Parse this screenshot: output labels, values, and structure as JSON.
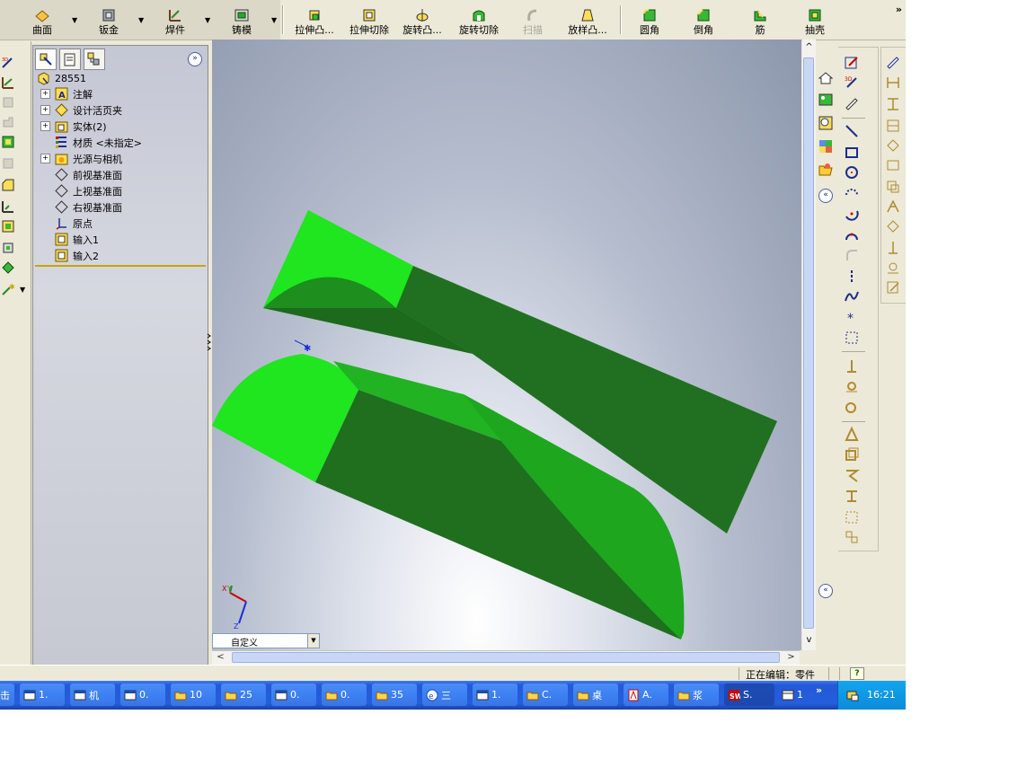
{
  "toolbar": {
    "buttons": [
      {
        "label": "曲面"
      },
      {
        "label": "钣金"
      },
      {
        "label": "焊件"
      },
      {
        "label": "铸模"
      },
      {
        "label": "拉伸凸..."
      },
      {
        "label": "拉伸切除"
      },
      {
        "label": "旋转凸..."
      },
      {
        "label": "旋转切除"
      },
      {
        "label": "扫描"
      },
      {
        "label": "放样凸..."
      },
      {
        "label": "圆角"
      },
      {
        "label": "倒角"
      },
      {
        "label": "筋"
      },
      {
        "label": "抽壳"
      }
    ],
    "more": "»"
  },
  "feature_tree": {
    "expand": "»",
    "root": "28551",
    "items": [
      {
        "label": "注解"
      },
      {
        "label": "设计活页夹"
      },
      {
        "label": "实体(2)"
      },
      {
        "label": "材质 <未指定>"
      },
      {
        "label": "光源与相机"
      },
      {
        "label": "前视基准面"
      },
      {
        "label": "上视基准面"
      },
      {
        "label": "右视基准面"
      },
      {
        "label": "原点"
      },
      {
        "label": "输入1"
      },
      {
        "label": "输入2"
      }
    ]
  },
  "viewport": {
    "view_combo": "自定义",
    "triad": {
      "x": "X",
      "y": "Y",
      "z": "Z"
    },
    "collapse": "«"
  },
  "statusbar": {
    "editing": "正在编辑：零件",
    "help": "?"
  },
  "taskbar": {
    "tasks": [
      {
        "label": "击"
      },
      {
        "label": "1."
      },
      {
        "label": "机"
      },
      {
        "label": "0."
      },
      {
        "label": "10"
      },
      {
        "label": "25"
      },
      {
        "label": "0."
      },
      {
        "label": "0."
      },
      {
        "label": "35"
      },
      {
        "label": "三"
      },
      {
        "label": "1."
      },
      {
        "label": "C."
      },
      {
        "label": "桌"
      },
      {
        "label": "A."
      },
      {
        "label": "浆"
      },
      {
        "label": "S."
      },
      {
        "label": "1"
      }
    ],
    "more": "»",
    "clock": "16:21"
  },
  "colors": {
    "part_light": "#1fe61f",
    "part_mid": "#22a622",
    "part_dark": "#1f6f1f",
    "taskbar": "#245edb"
  }
}
